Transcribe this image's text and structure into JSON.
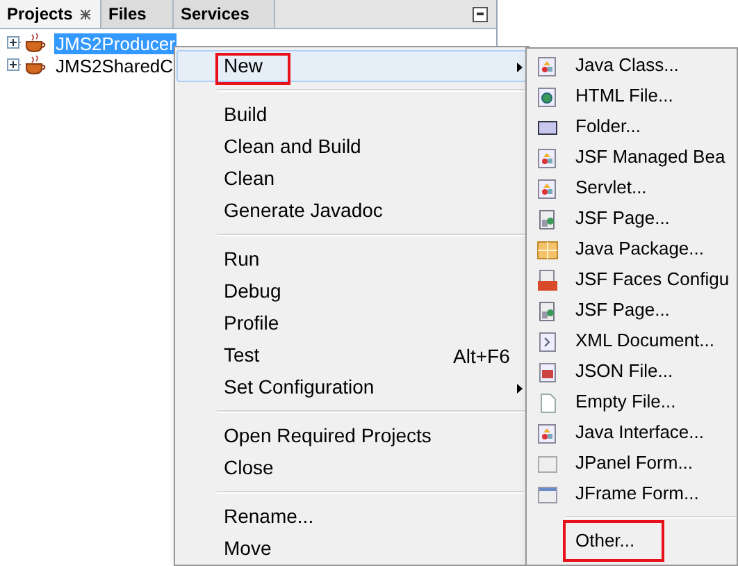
{
  "tabs": [
    {
      "label": "Projects",
      "selected": true
    },
    {
      "label": "Files",
      "selected": false
    },
    {
      "label": "Services",
      "selected": false
    }
  ],
  "tree": [
    {
      "label": "JMS2Producer",
      "expanded": false,
      "selected": true
    },
    {
      "label": "JMS2SharedC",
      "expanded": false,
      "selected": false
    }
  ],
  "context_menu": {
    "groups": [
      [
        {
          "label": "New",
          "submenu": true,
          "selected": true,
          "highlighted": true
        }
      ],
      [
        {
          "label": "Build",
          "submenu": false,
          "selected": false,
          "highlighted": false
        },
        {
          "label": "Clean and Build",
          "submenu": false,
          "selected": false,
          "highlighted": false
        },
        {
          "label": "Clean",
          "submenu": false,
          "selected": false,
          "highlighted": false
        },
        {
          "label": "Generate Javadoc",
          "submenu": false,
          "selected": false,
          "highlighted": false
        }
      ],
      [
        {
          "label": "Run",
          "submenu": false,
          "selected": false,
          "highlighted": false
        },
        {
          "label": "Debug",
          "submenu": false,
          "selected": false,
          "highlighted": false
        },
        {
          "label": "Profile",
          "submenu": false,
          "selected": false,
          "highlighted": false
        },
        {
          "label": "Test",
          "shortcut": "Alt+F6",
          "submenu": false,
          "selected": false,
          "highlighted": false
        },
        {
          "label": "Set Configuration",
          "submenu": true,
          "selected": false,
          "highlighted": false
        }
      ],
      [
        {
          "label": "Open Required Projects",
          "submenu": false,
          "selected": false,
          "highlighted": false
        },
        {
          "label": "Close",
          "submenu": false,
          "selected": false,
          "highlighted": false
        }
      ],
      [
        {
          "label": "Rename...",
          "submenu": false,
          "selected": false,
          "highlighted": false
        },
        {
          "label": "Move",
          "submenu": false,
          "selected": false,
          "highlighted": false
        }
      ]
    ]
  },
  "new_submenu": {
    "groups": [
      [
        {
          "label": "Java Class...",
          "kind": "class",
          "highlighted": false
        },
        {
          "label": "HTML File...",
          "kind": "html",
          "highlighted": false
        },
        {
          "label": "Folder...",
          "kind": "folder",
          "highlighted": false
        },
        {
          "label": "JSF Managed Bea",
          "kind": "class",
          "highlighted": false
        },
        {
          "label": "Servlet...",
          "kind": "class",
          "highlighted": false
        },
        {
          "label": "JSF Page...",
          "kind": "page",
          "highlighted": false
        },
        {
          "label": "Java Package...",
          "kind": "package",
          "highlighted": false
        },
        {
          "label": "JSF Faces Configu",
          "kind": "faces",
          "highlighted": false
        },
        {
          "label": "JSF Page...",
          "kind": "page",
          "highlighted": false
        },
        {
          "label": "XML Document...",
          "kind": "xml",
          "highlighted": false
        },
        {
          "label": "JSON File...",
          "kind": "json",
          "highlighted": false
        },
        {
          "label": "Empty File...",
          "kind": "empty",
          "highlighted": false
        },
        {
          "label": "Java Interface...",
          "kind": "class",
          "highlighted": false
        },
        {
          "label": "JPanel Form...",
          "kind": "panel",
          "highlighted": false
        },
        {
          "label": "JFrame Form...",
          "kind": "frame",
          "highlighted": false
        }
      ],
      [
        {
          "label": "Other...",
          "kind": "none",
          "highlighted": true
        }
      ]
    ]
  }
}
